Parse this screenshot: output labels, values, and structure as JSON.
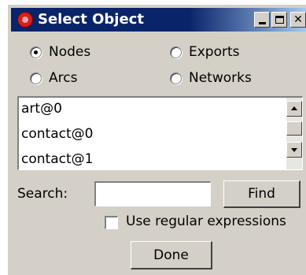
{
  "window": {
    "title": "Select Object",
    "controls": [
      "minimize-icon",
      "maximize-icon",
      "close-icon"
    ],
    "close_glyph": "✕"
  },
  "type_options": [
    {
      "label": "Nodes",
      "checked": true
    },
    {
      "label": "Exports",
      "checked": false
    },
    {
      "label": "Arcs",
      "checked": false
    },
    {
      "label": "Networks",
      "checked": false
    }
  ],
  "list": {
    "items": [
      "art@0",
      "contact@0",
      "contact@1"
    ]
  },
  "search": {
    "label": "Search:",
    "value": "",
    "find_label": "Find"
  },
  "regex": {
    "label": "Use regular expressions",
    "checked": false
  },
  "done_label": "Done",
  "colors": {
    "titlebar": "#0a246a",
    "face": "#d4d0c8"
  }
}
